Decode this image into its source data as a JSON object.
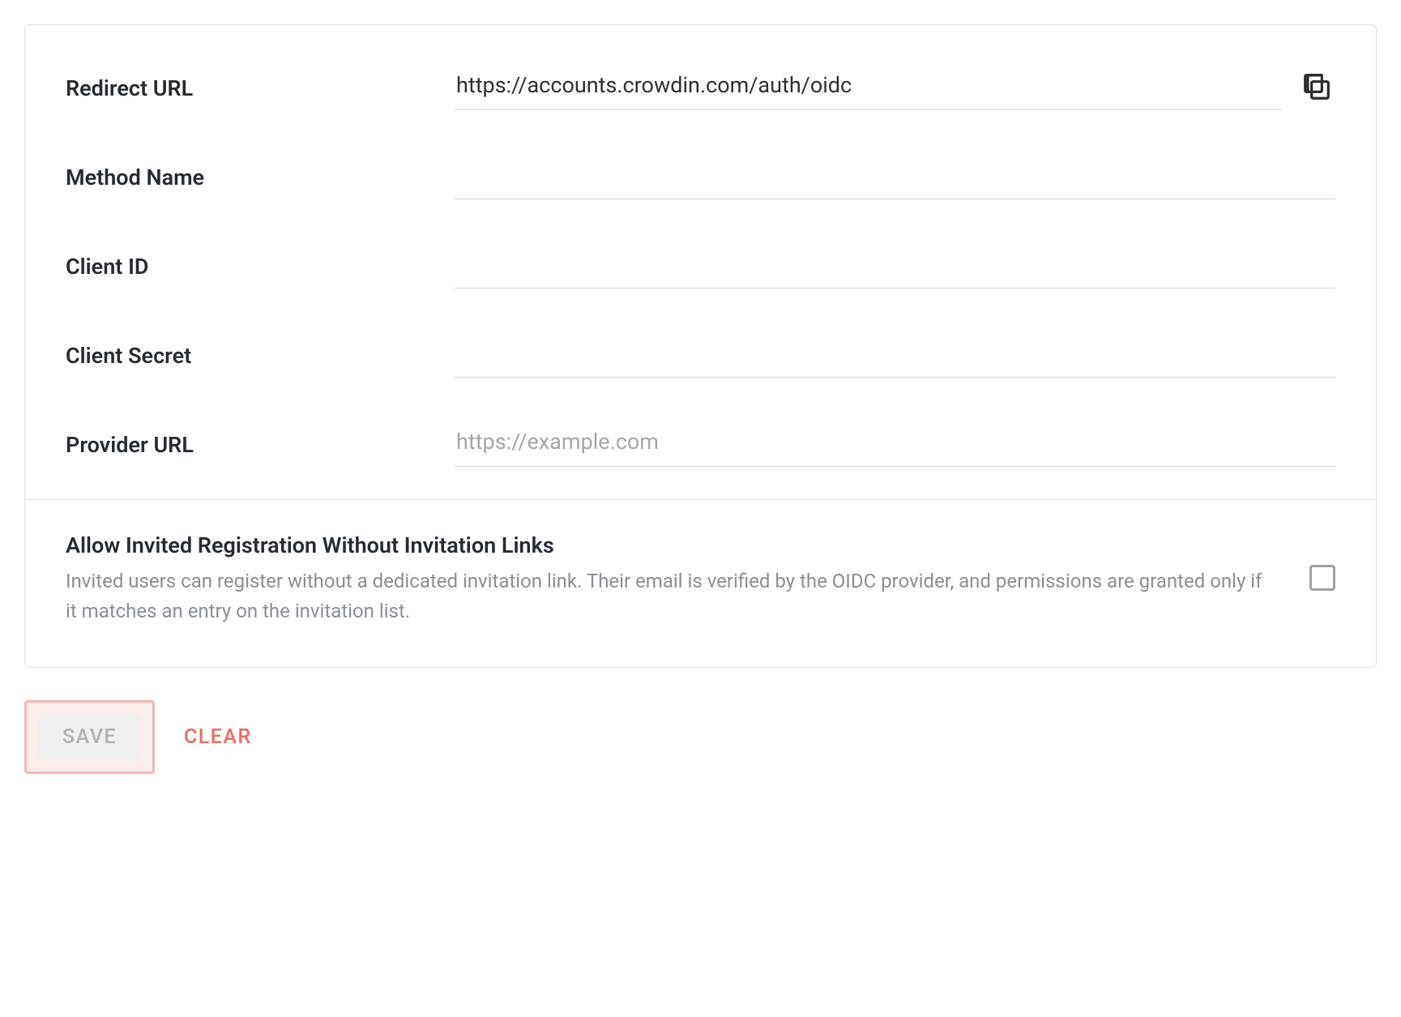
{
  "form": {
    "redirect_url": {
      "label": "Redirect URL",
      "value": "https://accounts.crowdin.com/auth/oidc"
    },
    "method_name": {
      "label": "Method Name",
      "value": ""
    },
    "client_id": {
      "label": "Client ID",
      "value": ""
    },
    "client_secret": {
      "label": "Client Secret",
      "value": ""
    },
    "provider_url": {
      "label": "Provider URL",
      "placeholder": "https://example.com",
      "value": ""
    }
  },
  "option": {
    "title": "Allow Invited Registration Without Invitation Links",
    "description": "Invited users can register without a dedicated invitation link. Their email is verified by the OIDC provider, and permissions are granted only if it matches an entry on the invitation list."
  },
  "actions": {
    "save": "SAVE",
    "clear": "CLEAR"
  },
  "icons": {
    "copy": "copy-icon"
  }
}
